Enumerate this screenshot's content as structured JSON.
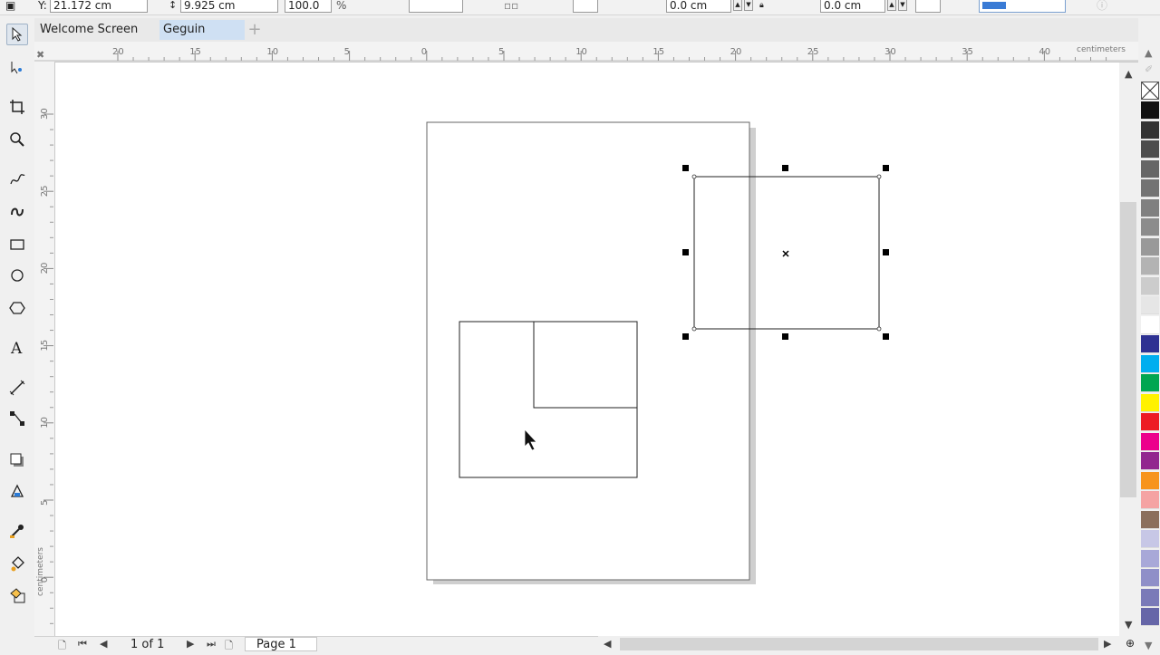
{
  "propbar": {
    "y_label": "Y:",
    "y_value": "21.172 cm",
    "h_value": "9.925 cm",
    "scale_value": "100.0",
    "scale_unit": "%",
    "offset1_value": "0.0 cm",
    "offset2_value": "0.0 cm"
  },
  "tabs": [
    {
      "label": "Welcome Screen"
    },
    {
      "label": "Geguin"
    }
  ],
  "tab_add": "+",
  "ruler": {
    "unit": "centimeters",
    "h_ticks": [
      "20",
      "15",
      "10",
      "5",
      "0",
      "5",
      "10",
      "15",
      "20",
      "25",
      "30",
      "35",
      "40"
    ],
    "v_ticks": [
      "30",
      "25",
      "20",
      "15",
      "10",
      "5",
      "0"
    ]
  },
  "status": {
    "page_count": "1 of 1",
    "page_tab": "Page 1"
  },
  "palette": [
    "#111111",
    "#333333",
    "#4d4d4d",
    "#666666",
    "#737373",
    "#808080",
    "#8c8c8c",
    "#999999",
    "#b3b3b3",
    "#cccccc",
    "#e6e6e6",
    "#ffffff",
    "#2e3192",
    "#00aeef",
    "#00a651",
    "#fff200",
    "#ed1c24",
    "#ec008c",
    "#92278f",
    "#f7941d",
    "#f5a3a3",
    "#8b6f5c",
    "#c7c7e6",
    "#a8a8d8",
    "#8f8fc8",
    "#7a7ab8",
    "#6666a8"
  ],
  "icons": {
    "select": "pick-tool-icon",
    "shape": "shape-tool-icon",
    "crop": "crop-tool-icon",
    "zoom": "zoom-tool-icon",
    "freehand": "freehand-tool-icon",
    "artistic": "artistic-media-icon",
    "rectangle": "rectangle-tool-icon",
    "ellipse": "ellipse-tool-icon",
    "polygon": "polygon-tool-icon",
    "text": "text-tool-icon",
    "dimension": "parallel-dimension-icon",
    "connector": "connector-tool-icon",
    "shadow": "drop-shadow-icon",
    "transparency": "transparency-tool-icon",
    "eyedropper": "eyedropper-icon",
    "fill": "interactive-fill-icon",
    "smartfill": "smart-fill-icon"
  }
}
